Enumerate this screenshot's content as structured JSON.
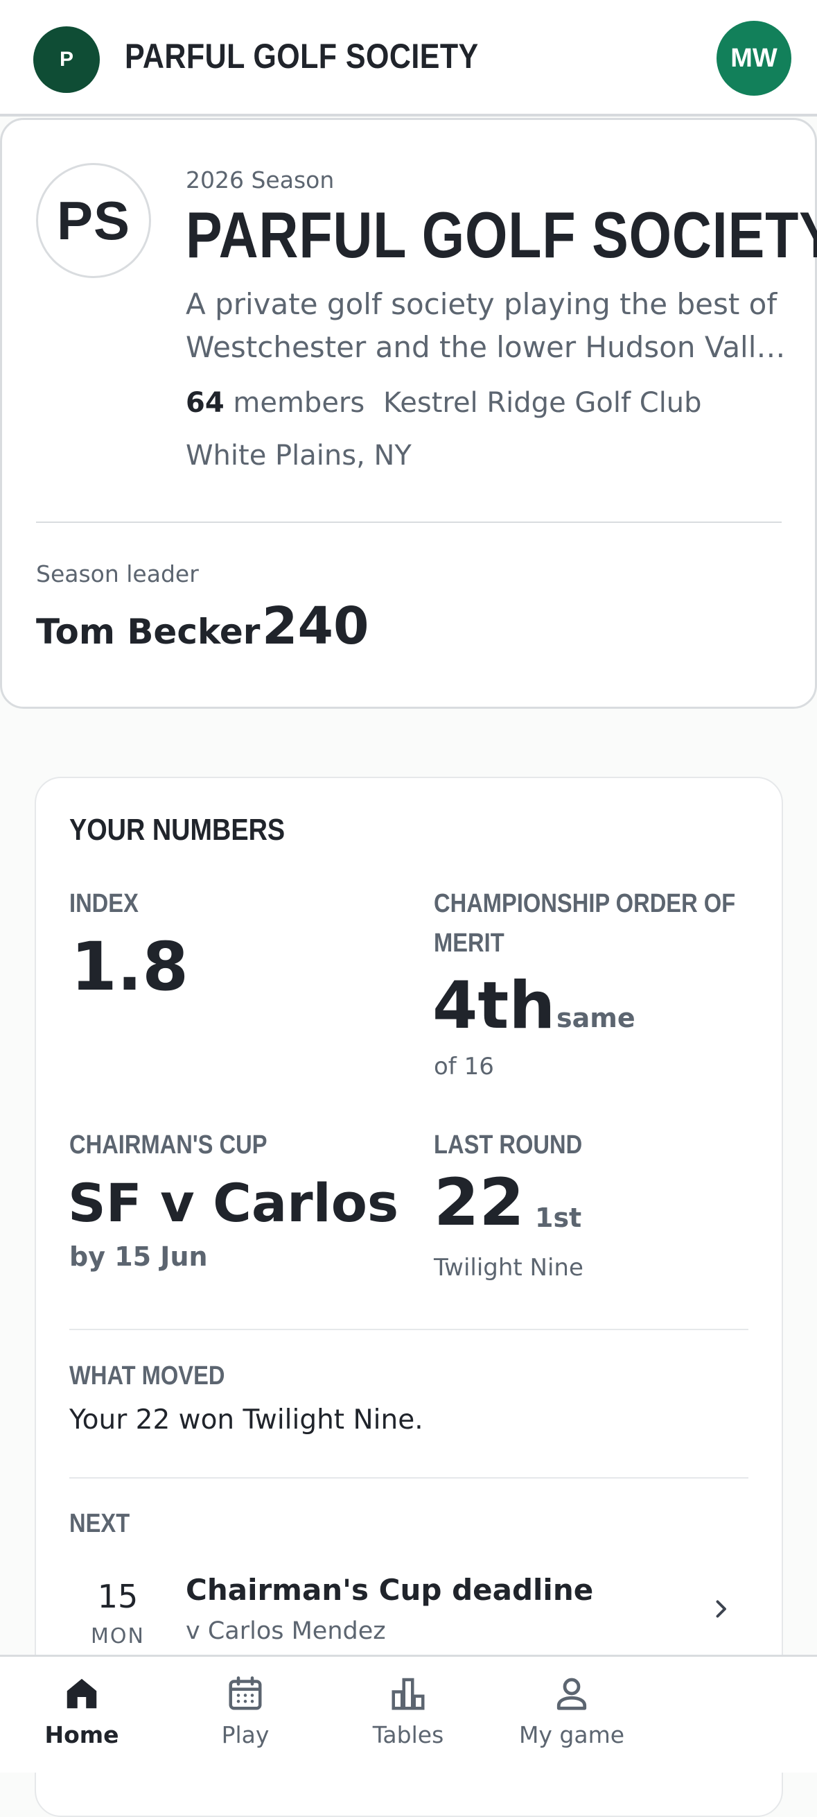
{
  "header": {
    "club_initial": "P",
    "title": "PARFUL GOLF SOCIETY",
    "user_initials": "MW"
  },
  "society": {
    "monogram": "PS",
    "season": "2026 Season",
    "name": "PARFUL GOLF SOCIETY",
    "description_line1": "A private golf society playing the best of",
    "description_line2": "Westchester and the lower Hudson Valle...",
    "members_count": "64",
    "members_label": "members",
    "home_club": "Kestrel Ridge Golf Club",
    "location": "White Plains, NY",
    "leader_label": "Season leader",
    "leader_name": "Tom Becker",
    "leader_points": "240"
  },
  "numbers": {
    "title": "YOUR NUMBERS",
    "index_label": "INDEX",
    "index_value": "1.8",
    "oom_label_line1": "CHAMPIONSHIP ORDER OF",
    "oom_label_line2": "MERIT",
    "oom_position": "4th",
    "oom_trend": "same",
    "oom_of": "of 16",
    "cup_label": "CHAIRMAN'S CUP",
    "cup_match": "SF v Carlos",
    "cup_deadline": "by 15 Jun",
    "last_label": "LAST ROUND",
    "last_score": "22",
    "last_place": "1st",
    "last_event": "Twilight Nine",
    "moved_label": "WHAT MOVED",
    "moved_text": "Your 22 won Twilight Nine.",
    "next_label": "NEXT",
    "next_day": "15",
    "next_dow": "MON",
    "next_title": "Chairman's Cup deadline",
    "next_sub": "v Carlos Mendez"
  },
  "nav": {
    "home": "Home",
    "play": "Play",
    "tables": "Tables",
    "my_game": "My game",
    "active": "Home"
  },
  "colors": {
    "brand_dark_green": "#0f4d35",
    "brand_green": "#12805a",
    "text_primary": "#20242b",
    "text_secondary": "#5c6570"
  }
}
